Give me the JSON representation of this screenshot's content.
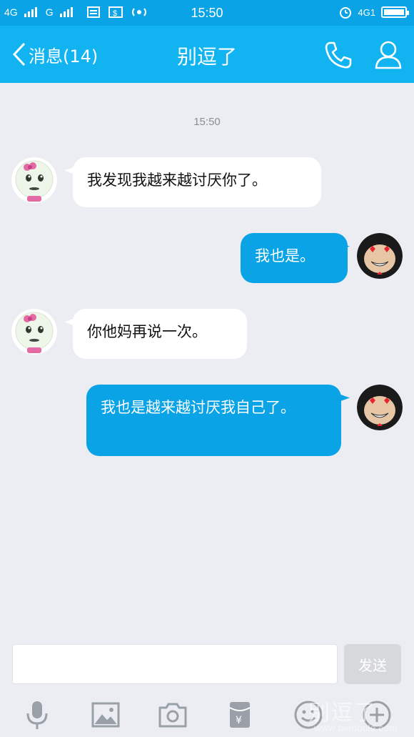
{
  "status_bar": {
    "net1": "4G",
    "net2": "G",
    "time": "15:50",
    "net_right": "4G1"
  },
  "header": {
    "back_label": "消息(14)",
    "title": "别逗了"
  },
  "conversation": {
    "timestamp": "15:50",
    "messages": [
      {
        "side": "in",
        "text": "我发现我越来越讨厌你了。"
      },
      {
        "side": "out",
        "text": "我也是。"
      },
      {
        "side": "in",
        "text": "你他妈再说一次。"
      },
      {
        "side": "out",
        "text": "我也是越来越讨厌我自己了。"
      }
    ]
  },
  "composer": {
    "input_value": "",
    "send_label": "发送"
  },
  "toolbar": {
    "items": [
      "microphone-icon",
      "image-icon",
      "camera-icon",
      "red-packet-icon",
      "emoji-icon",
      "plus-icon"
    ]
  },
  "watermark": {
    "title": "别逗了",
    "url": "www.biedoule.com"
  },
  "colors": {
    "accent": "#11b3f0",
    "bubble_out": "#0aa3e6",
    "background": "#ebedf2"
  }
}
